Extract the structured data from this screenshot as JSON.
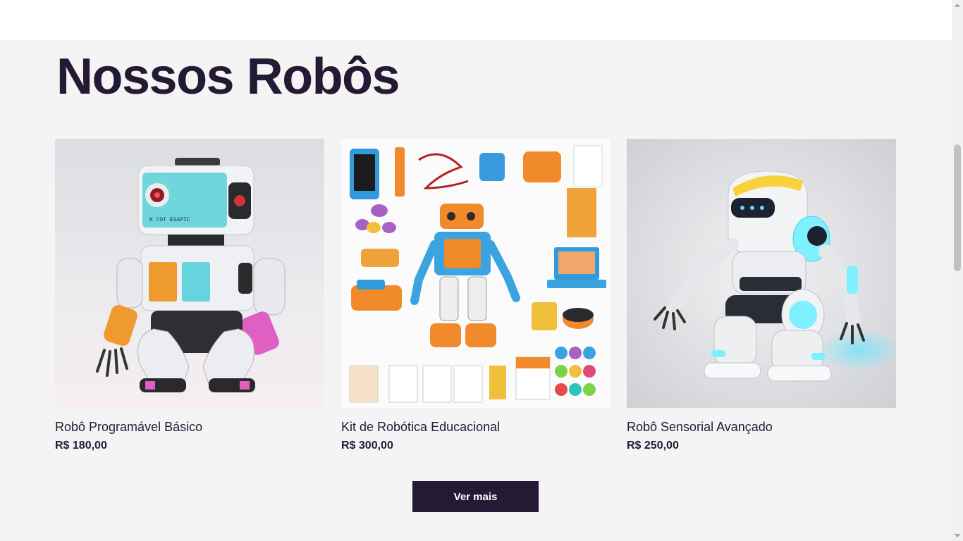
{
  "section": {
    "title": "Nossos Robôs"
  },
  "products": [
    {
      "name": "Robô Programável Básico",
      "price": "R$ 180,00",
      "image_icon": "robot-basic-image"
    },
    {
      "name": "Kit de Robótica Educacional",
      "price": "R$ 300,00",
      "image_icon": "robotics-kit-image"
    },
    {
      "name": "Robô Sensorial Avançado",
      "price": "R$ 250,00",
      "image_icon": "robot-sensorial-image"
    }
  ],
  "actions": {
    "more_label": "Ver mais"
  },
  "colors": {
    "primary": "#241a33",
    "background": "#f4f4f5",
    "accent": "#7b2f8f"
  }
}
